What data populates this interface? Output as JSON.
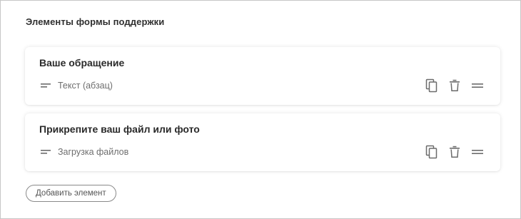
{
  "section": {
    "title": "Элементы формы поддержки"
  },
  "elements": [
    {
      "title": "Ваше обращение",
      "type_label": "Текст (абзац)",
      "type_icon": "short-text-icon"
    },
    {
      "title": "Прикрепите ваш файл или фото",
      "type_label": "Загрузка файлов",
      "type_icon": "short-text-icon"
    }
  ],
  "actions": {
    "copy_icon": "copy-icon",
    "delete_icon": "trash-icon",
    "drag_icon": "drag-handle-icon"
  },
  "add_button": {
    "label": "Добавить элемент"
  },
  "colors": {
    "border": "#c6c6c6",
    "title_text": "#2a2a2a",
    "muted_text": "#6e6e6e",
    "icon": "#6b6b6b"
  }
}
